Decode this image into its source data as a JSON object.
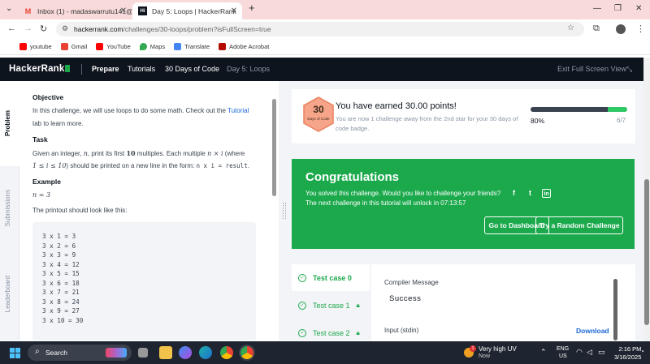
{
  "browser": {
    "tabs": [
      {
        "title": "Inbox (1) - madaswarrutu141@",
        "favicon": "gmail-icon",
        "active": false
      },
      {
        "title": "Day 5: Loops | HackerRank",
        "favicon": "hackerrank-icon",
        "active": true
      }
    ],
    "url_prefix": "hackerrank.com",
    "url_rest": "/challenges/30-loops/problem?isFullScreen=true",
    "bookmarks": [
      {
        "label": "youtube",
        "color": "#ff0000"
      },
      {
        "label": "Gmail",
        "color": "#ea4335"
      },
      {
        "label": "YouTube",
        "color": "#ff0000"
      },
      {
        "label": "Maps",
        "color": "#34a853"
      },
      {
        "label": "Translate",
        "color": "#4285f4"
      },
      {
        "label": "Adobe Acrobat",
        "color": "#b30b00"
      }
    ]
  },
  "hr": {
    "logo": "HackerRank",
    "nav": [
      "Prepare",
      "Tutorials",
      "30 Days of Code",
      "Day 5: Loops"
    ],
    "exit_fullscreen": "Exit Full Screen View",
    "side_tabs": [
      "Problem",
      "Submissions",
      "Leaderboard"
    ]
  },
  "problem": {
    "objective_heading": "Objective",
    "objective_line1_a": "In this challenge, we will use loops to do some math. Check out the ",
    "tutorial_link": "Tutorial",
    "objective_line2": "tab to learn more.",
    "task_heading": "Task",
    "task_line1_a": "Given an integer, ",
    "task_n": "n",
    "task_line1_b": ", print its first ",
    "task_10": "10",
    "task_line1_c": " multiples. Each multiple ",
    "task_nxi": "n × i",
    "task_line1_d": " (where",
    "task_range": "1 ≤ i ≤ 10",
    "task_line2_b": ") should be printed on a new line in the form: ",
    "task_form": "n x i = result",
    "task_line2_c": ".",
    "example_heading": "Example",
    "example_value": "n = 3",
    "printout_text": "The printout should look like this:",
    "code_lines": [
      "3 x 1 = 3",
      "3 x 2 = 6",
      "3 x 3 = 9",
      "3 x 4 = 12",
      "3 x 5 = 15",
      "3 x 6 = 18",
      "3 x 7 = 21",
      "3 x 8 = 24",
      "3 x 9 = 27",
      "3 x 10 = 30"
    ]
  },
  "points": {
    "badge_number": "30",
    "badge_text": "Days of Code",
    "earned": "You have earned 30.00 points!",
    "sub": "You are now 1 challenge away from the 2nd star for your 30 days of code badge.",
    "progress_pct_label": "80%",
    "progress_fraction": "6/7",
    "progress_value": 0.8
  },
  "congrats": {
    "title": "Congratulations",
    "line1": "You solved this challenge. Would you like to challenge your friends?",
    "line2": "The next challenge in this tutorial will unlock in 07:13:57",
    "dashboard_btn": "Go to Dashboard",
    "random_btn": "Try a Random Challenge",
    "social": [
      "f",
      "t",
      "in"
    ]
  },
  "testcases": {
    "items": [
      "Test case 0",
      "Test case 1",
      "Test case 2"
    ],
    "compiler_label": "Compiler Message",
    "compiler_value": "Success",
    "stdin_label": "Input (stdin)",
    "download": "Download"
  },
  "taskbar": {
    "search": "Search",
    "weather_title": "Very high UV",
    "weather_sub": "Now",
    "lang1": "ENG",
    "lang2": "US",
    "time": "2:16 PM",
    "date": "3/16/2025"
  }
}
